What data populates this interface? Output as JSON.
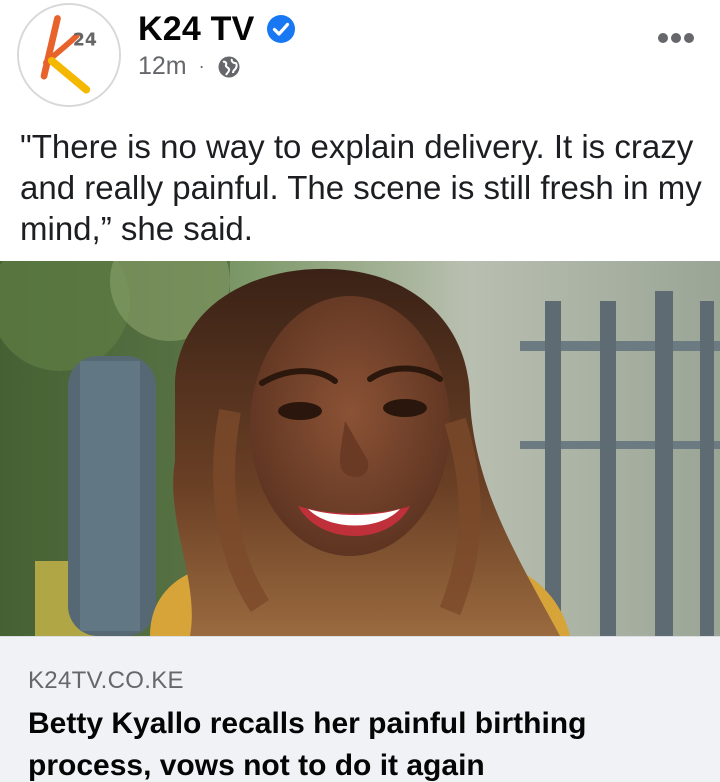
{
  "post": {
    "page_name": "K24 TV",
    "verified": true,
    "timestamp": "12m",
    "separator": "·",
    "audience_icon": "globe-icon",
    "more_icon": "more-options-icon",
    "text": "\"There is no way to explain delivery. It is crazy and really painful. The scene is still fresh in my mind,” she said."
  },
  "avatar": {
    "logo_letter": "k",
    "logo_number": "24",
    "logo_color": "#e8622c",
    "accent_color": "#f5b800"
  },
  "link_preview": {
    "domain": "K24TV.CO.KE",
    "title": "Betty Kyallo recalls her painful birthing process, vows not to do it again"
  },
  "colors": {
    "verified_badge": "#1877f2",
    "secondary_text": "#65676b",
    "card_background": "#f0f2f5"
  }
}
